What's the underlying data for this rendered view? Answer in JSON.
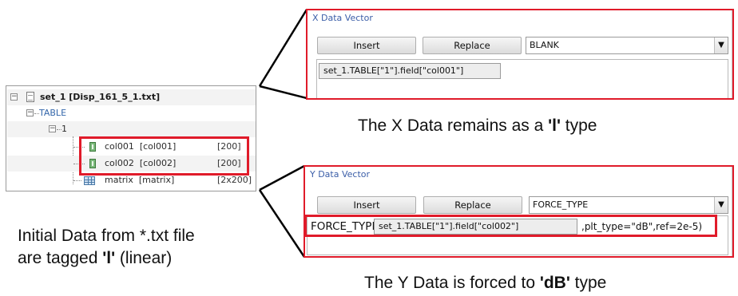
{
  "tree": {
    "root_label": "set_1 [Disp_161_5_1.txt]",
    "table_label": "TABLE",
    "group_label": "1",
    "items": [
      {
        "label": "col001  [col001]",
        "size": "[200]"
      },
      {
        "label": "col002  [col002]",
        "size": "[200]"
      },
      {
        "label": "matrix  [matrix]",
        "size": "[2x200]"
      }
    ]
  },
  "captions": {
    "left_line1": "Initial Data from *.txt file",
    "left_line2_pre": "are tagged ",
    "left_line2_bold": "'l'",
    "left_line2_post": " (linear)",
    "x_pre": "The X Data remains as a ",
    "x_bold": "'l'",
    "x_post": " type",
    "y_pre": "The Y Data is forced to ",
    "y_bold": "'dB'",
    "y_post": " type"
  },
  "x_vector": {
    "title": "X Data Vector",
    "insert_label": "Insert",
    "replace_label": "Replace",
    "combo_value": "BLANK",
    "expression": "set_1.TABLE[\"1\"].field[\"col001\"]"
  },
  "y_vector": {
    "title": "Y Data Vector",
    "insert_label": "Insert",
    "replace_label": "Replace",
    "combo_value": "FORCE_TYPE",
    "expr_prefix": "FORCE_TYPE(",
    "expression": "set_1.TABLE[\"1\"].field[\"col002\"]",
    "expr_suffix": ",plt_type=\"dB\",ref=2e-5)"
  },
  "colors": {
    "highlight": "#e01b2a",
    "panel_title": "#3b5ea8",
    "tree_link": "#3366aa"
  },
  "icons": {
    "expand": "minus-square",
    "dropdown": "triangle-down"
  }
}
